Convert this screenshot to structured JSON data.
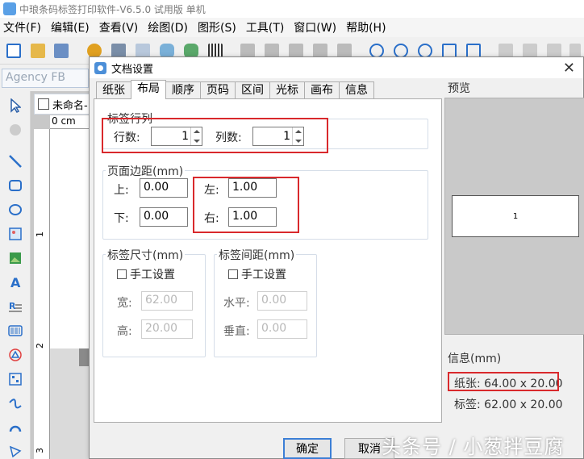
{
  "app": {
    "title": "中琅条码标签打印软件-V6.5.0 试用版 单机"
  },
  "menu": [
    "文件(F)",
    "编辑(E)",
    "查看(V)",
    "绘图(D)",
    "图形(S)",
    "工具(T)",
    "窗口(W)",
    "帮助(H)"
  ],
  "font_box": "Agency FB",
  "document": {
    "tab_label": "未命名-1",
    "ruler_top": "0 cm",
    "ruler_marks": [
      "1",
      "2",
      "3"
    ]
  },
  "dialog": {
    "title": "文档设置",
    "close": "✕",
    "tabs": [
      "纸张",
      "布局",
      "顺序",
      "页码",
      "区间",
      "光标",
      "画布",
      "信息"
    ],
    "active_tab": "布局",
    "rows_cols": {
      "title": "标签行列",
      "rows_label": "行数:",
      "rows_value": "1",
      "cols_label": "列数:",
      "cols_value": "1"
    },
    "margins": {
      "title": "页面边距(mm)",
      "top_label": "上:",
      "top_value": "0.00",
      "bottom_label": "下:",
      "bottom_value": "0.00",
      "left_label": "左:",
      "left_value": "1.00",
      "right_label": "右:",
      "right_value": "1.00"
    },
    "label_size": {
      "title": "标签尺寸(mm)",
      "manual_label": "手工设置",
      "width_label": "宽:",
      "width_value": "62.00",
      "height_label": "高:",
      "height_value": "20.00"
    },
    "label_spacing": {
      "title": "标签间距(mm)",
      "manual_label": "手工设置",
      "h_label": "水平:",
      "h_value": "0.00",
      "v_label": "垂直:",
      "v_value": "0.00"
    },
    "preview": {
      "title": "预览",
      "label_number": "1"
    },
    "info": {
      "title": "信息(mm)",
      "paper": "纸张: 64.00 x 20.00",
      "label": "标签: 62.00 x 20.00"
    },
    "ok": "确定",
    "cancel": "取消"
  },
  "watermark": "头条号 / 小葱拌豆腐",
  "colors": {
    "highlight_red": "#d9292c",
    "accent_blue": "#3c7fd6"
  }
}
